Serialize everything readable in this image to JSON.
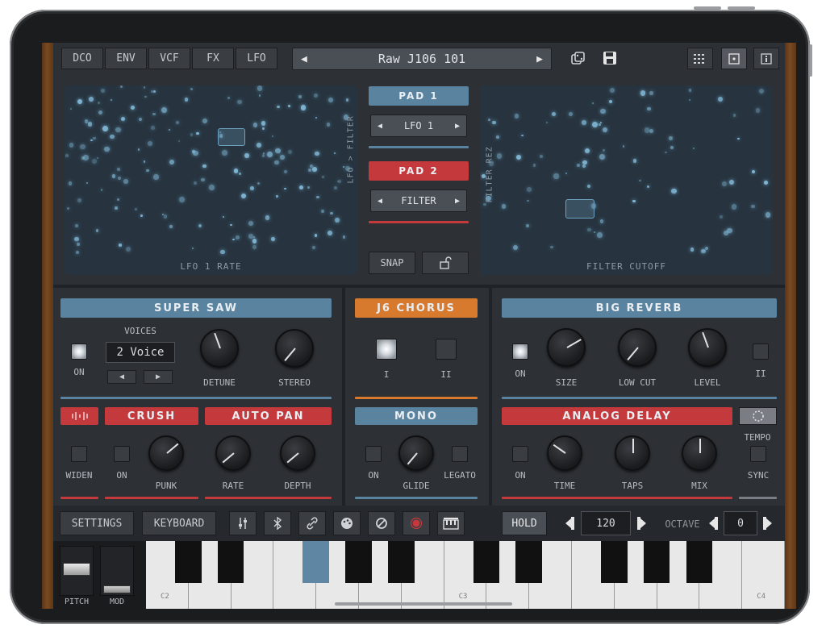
{
  "tabs": [
    "DCO",
    "ENV",
    "VCF",
    "FX",
    "LFO"
  ],
  "preset": {
    "name": "Raw J106 101",
    "prev": "◀",
    "next": "▶"
  },
  "pads": {
    "left_xlabel": "LFO 1 RATE",
    "left_ylabel": "LFO > FILTER",
    "right_xlabel": "FILTER CUTOFF",
    "right_ylabel": "FILTER REZ",
    "pad1": "PAD 1",
    "pad1_target": "LFO 1",
    "pad2": "PAD 2",
    "pad2_target": "FILTER",
    "snap": "SNAP"
  },
  "supersaw": {
    "title": "SUPER SAW",
    "voices_label": "VOICES",
    "voices_value": "2 Voice",
    "on": "ON",
    "detune": "DETUNE",
    "stereo": "STEREO"
  },
  "chorus": {
    "title": "J6 CHORUS",
    "i": "I",
    "ii": "II"
  },
  "reverb": {
    "title": "BIG REVERB",
    "on": "ON",
    "size": "SIZE",
    "lowcut": "LOW CUT",
    "level": "LEVEL",
    "ii": "II"
  },
  "crush": {
    "title": "CRUSH",
    "widen": "WIDEN",
    "on": "ON",
    "punk": "PUNK"
  },
  "autopan": {
    "title": "AUTO PAN",
    "rate": "RATE",
    "depth": "DEPTH"
  },
  "mono": {
    "title": "MONO",
    "on": "ON",
    "glide": "GLIDE",
    "legato": "LEGATO"
  },
  "delay": {
    "title": "ANALOG DELAY",
    "on": "ON",
    "time": "TIME",
    "taps": "TAPS",
    "mix": "MIX",
    "tempo": "TEMPO",
    "sync": "SYNC"
  },
  "bottom": {
    "settings": "SETTINGS",
    "keyboard": "KEYBOARD",
    "hold": "HOLD",
    "tempo_value": "120",
    "octave_label": "OCTAVE",
    "octave_value": "0"
  },
  "keys": {
    "pitch": "PITCH",
    "mod": "MOD",
    "c2": "C2",
    "c3": "C3",
    "c4": "C4"
  },
  "colors": {
    "blue": "#5a83a0",
    "red": "#c4393c",
    "orange": "#d87a2e"
  }
}
